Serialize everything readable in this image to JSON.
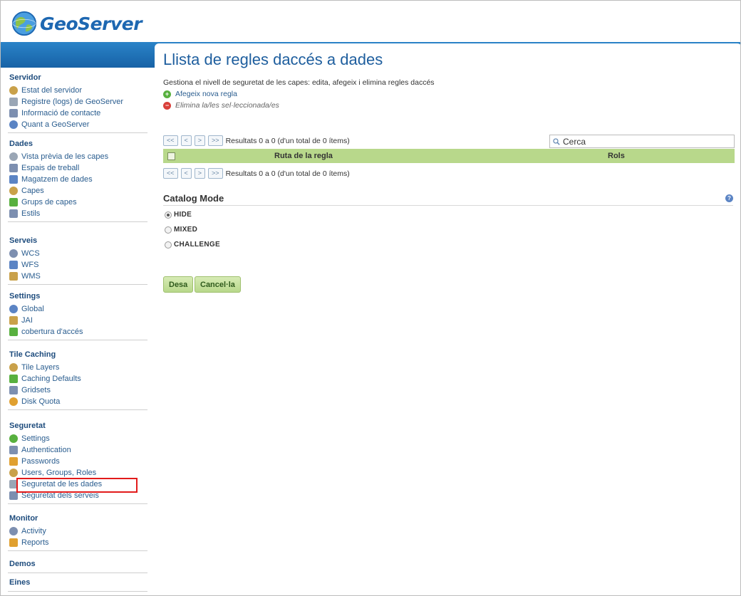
{
  "header": {
    "logo_text": "GeoServer"
  },
  "sidebar": {
    "sections": [
      {
        "title": "Servidor",
        "items": [
          "Estat del servidor",
          "Registre (logs) de GeoServer",
          "Informació de contacte",
          "Quant a GeoServer"
        ]
      },
      {
        "title": "Dades",
        "items": [
          "Vista prèvia de les capes",
          "Espais de treball",
          "Magatzem de dades",
          "Capes",
          "Grups de capes",
          "Estils"
        ]
      },
      {
        "title": "Serveis",
        "items": [
          "WCS",
          "WFS",
          "WMS"
        ]
      },
      {
        "title": "Settings",
        "items": [
          "Global",
          "JAI",
          "cobertura d'accés"
        ]
      },
      {
        "title": "Tile Caching",
        "items": [
          "Tile Layers",
          "Caching Defaults",
          "Gridsets",
          "Disk Quota"
        ]
      },
      {
        "title": "Seguretat",
        "items": [
          "Settings",
          "Authentication",
          "Passwords",
          "Users, Groups, Roles",
          "Seguretat de les dades",
          "Seguretat dels serveis"
        ]
      },
      {
        "title": "Monitor",
        "items": [
          "Activity",
          "Reports"
        ]
      },
      {
        "title": "Demos",
        "items": []
      },
      {
        "title": "Eines",
        "items": []
      }
    ]
  },
  "main": {
    "title": "Llista de regles daccés a dades",
    "description": "Gestiona el nivell de seguretat de les capes: edita, afegeix i elimina regles daccés",
    "add_rule": "Afegeix nova regla",
    "remove_selected": "Elimina la/les sel·leccionada/es",
    "pager": {
      "first": "<<",
      "prev": "<",
      "next": ">",
      "last": ">>",
      "results": "Resultats 0 a 0 (d'un total de 0 ítems)"
    },
    "search": {
      "value": "Cerca"
    },
    "table": {
      "col_rule_path": "Ruta de la regla",
      "col_roles": "Rols"
    },
    "catalog_mode": {
      "title": "Catalog Mode",
      "options": [
        "HIDE",
        "MIXED",
        "CHALLENGE"
      ],
      "selected": "HIDE"
    },
    "buttons": {
      "save": "Desa",
      "cancel": "Cancel·la"
    }
  },
  "colors": {
    "header_blue": "#1d67b1",
    "table_header": "#b8d88b",
    "highlight": "#e21b1b"
  }
}
